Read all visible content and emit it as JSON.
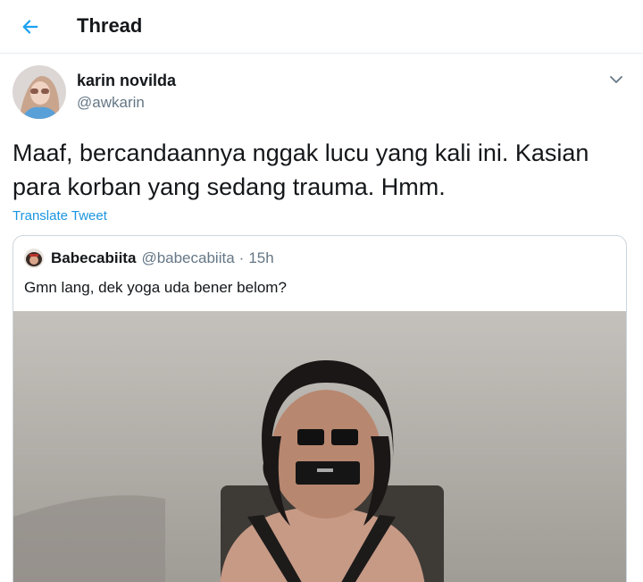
{
  "header": {
    "title": "Thread"
  },
  "tweet": {
    "author_name": "karin novilda",
    "author_handle": "@awkarin",
    "text": "Maaf, bercandaannya nggak lucu yang kali ini. Kasian para korban yang sedang trauma. Hmm.",
    "translate_label": "Translate Tweet"
  },
  "quoted_tweet": {
    "author_name": "Babecabiita",
    "author_handle": "@babecabiita",
    "separator": "·",
    "time": "15h",
    "text": "Gmn lang, dek yoga uda bener belom?"
  },
  "icons": {
    "back": "arrow-left-icon",
    "caret": "chevron-down-icon"
  },
  "colors": {
    "accent": "#1da1f2",
    "link": "#1b95e0",
    "secondary_text": "#657786",
    "border": "#e6ecf0"
  }
}
